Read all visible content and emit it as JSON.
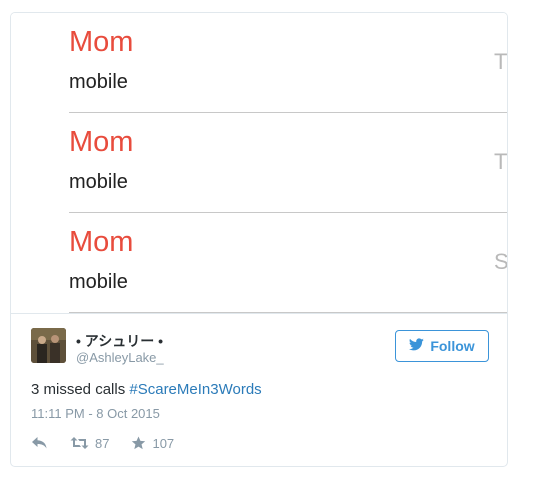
{
  "screenshot": {
    "rows": [
      {
        "name": "Mom",
        "type": "mobile",
        "side": "T"
      },
      {
        "name": "Mom",
        "type": "mobile",
        "side": "T"
      },
      {
        "name": "Mom",
        "type": "mobile",
        "side": "S"
      }
    ]
  },
  "tweet": {
    "display_name": "• アシュリー •",
    "handle": "@AshleyLake_",
    "follow_label": "Follow",
    "text_plain": "3 missed calls ",
    "hashtag": "#ScareMeIn3Words",
    "timestamp": "11:11 PM - 8 Oct 2015",
    "retweets": "87",
    "likes": "107"
  },
  "colors": {
    "accent": "#3b94d9",
    "hashtag": "#2b7bb9",
    "call_name": "#e84c3d",
    "muted": "#8899a6"
  },
  "icons": {
    "follow": "twitter-bird-icon",
    "reply": "reply-icon",
    "retweet": "retweet-icon",
    "like": "star-icon"
  }
}
